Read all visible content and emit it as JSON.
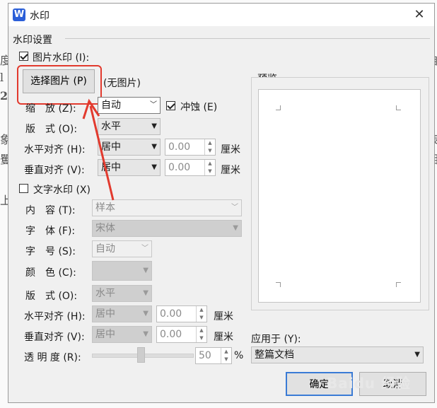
{
  "dialog": {
    "title": "水印",
    "close_glyph": "✕",
    "app_icon_letter": "W"
  },
  "settings_group": "水印设置",
  "picture": {
    "checkbox_label": "图片水印 (I):",
    "checked": true,
    "select_button": "选择图片 (P)",
    "no_image": "(无图片)",
    "scale_label": "缩　放 (Z):",
    "scale_value": "自动",
    "washout_label": "冲蚀 (E)",
    "washout_checked": true,
    "layout_label": "版　式 (O):",
    "layout_value": "水平",
    "halign_label": "水平对齐 (H):",
    "halign_value": "居中",
    "halign_offset": "0.00",
    "valign_label": "垂直对齐 (V):",
    "valign_value": "居中",
    "valign_offset": "0.00",
    "unit": "厘米"
  },
  "text": {
    "checkbox_label": "文字水印 (X)",
    "checked": false,
    "content_label": "内　容 (T):",
    "content_value": "样本",
    "font_label": "字　体 (F):",
    "font_value": "宋体",
    "size_label": "字　号 (S):",
    "size_value": "自动",
    "color_label": "颜　色 (C):",
    "layout_label": "版　式 (O):",
    "layout_value": "水平",
    "halign_label": "水平对齐 (H):",
    "halign_value": "居中",
    "halign_offset": "0.00",
    "valign_label": "垂直对齐 (V):",
    "valign_value": "居中",
    "valign_offset": "0.00",
    "unit": "厘米",
    "transparency_label": "透 明 度 (R):",
    "transparency_value": "50",
    "transparency_unit": "%",
    "transparency_level": 0.5
  },
  "preview": {
    "label": "预览"
  },
  "apply": {
    "label": "应用于 (Y):",
    "value": "整篇文档"
  },
  "buttons": {
    "ok": "确定",
    "cancel": "取消"
  },
  "overlay": {
    "watermark_text": "Baidu 经验"
  },
  "colors": {
    "annotation_red": "#e23a2e",
    "focus_blue": "#3a7bd5",
    "app_blue": "#2b5fd8"
  }
}
